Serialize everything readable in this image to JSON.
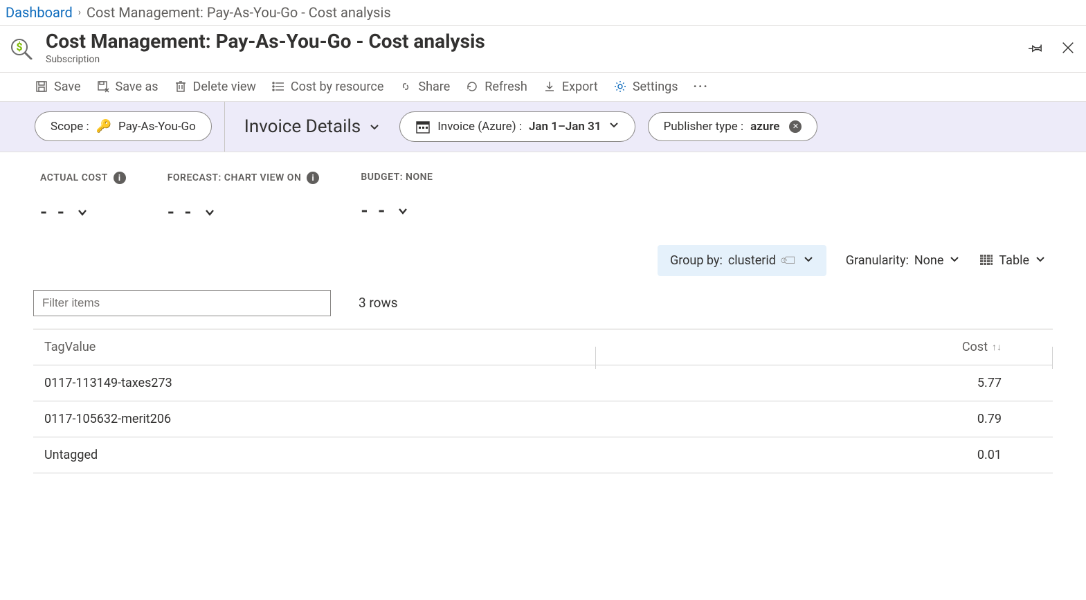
{
  "breadcrumb": {
    "root": "Dashboard",
    "current": "Cost Management: Pay-As-You-Go - Cost analysis"
  },
  "header": {
    "title": "Cost Management: Pay-As-You-Go - Cost analysis",
    "subtitle": "Subscription"
  },
  "toolbar": {
    "save": "Save",
    "save_as": "Save as",
    "delete_view": "Delete view",
    "cost_by_resource": "Cost by resource",
    "share": "Share",
    "refresh": "Refresh",
    "export": "Export",
    "settings": "Settings"
  },
  "scopebar": {
    "scope_label": "Scope :",
    "scope_value": "Pay-As-You-Go",
    "view_name": "Invoice Details",
    "invoice_label": "Invoice (Azure) :",
    "invoice_value": "Jan 1–Jan 31",
    "publisher_label": "Publisher type :",
    "publisher_value": "azure"
  },
  "stats": {
    "actual_cost": {
      "label": "ACTUAL COST",
      "value": "- -"
    },
    "forecast": {
      "label": "FORECAST: CHART VIEW ON",
      "value": "- -"
    },
    "budget": {
      "label": "BUDGET: NONE",
      "value": "- -"
    }
  },
  "controls": {
    "group_by_label": "Group by:",
    "group_by_value": "clusterid",
    "granularity_label": "Granularity:",
    "granularity_value": "None",
    "view_mode": "Table"
  },
  "filter": {
    "placeholder": "Filter items",
    "rows_label": "3 rows"
  },
  "table": {
    "columns": {
      "tag": "TagValue",
      "cost": "Cost"
    },
    "rows": [
      {
        "tag": "0117-113149-taxes273",
        "cost": "5.77"
      },
      {
        "tag": "0117-105632-merit206",
        "cost": "0.79"
      },
      {
        "tag": "Untagged",
        "cost": "0.01"
      }
    ]
  }
}
